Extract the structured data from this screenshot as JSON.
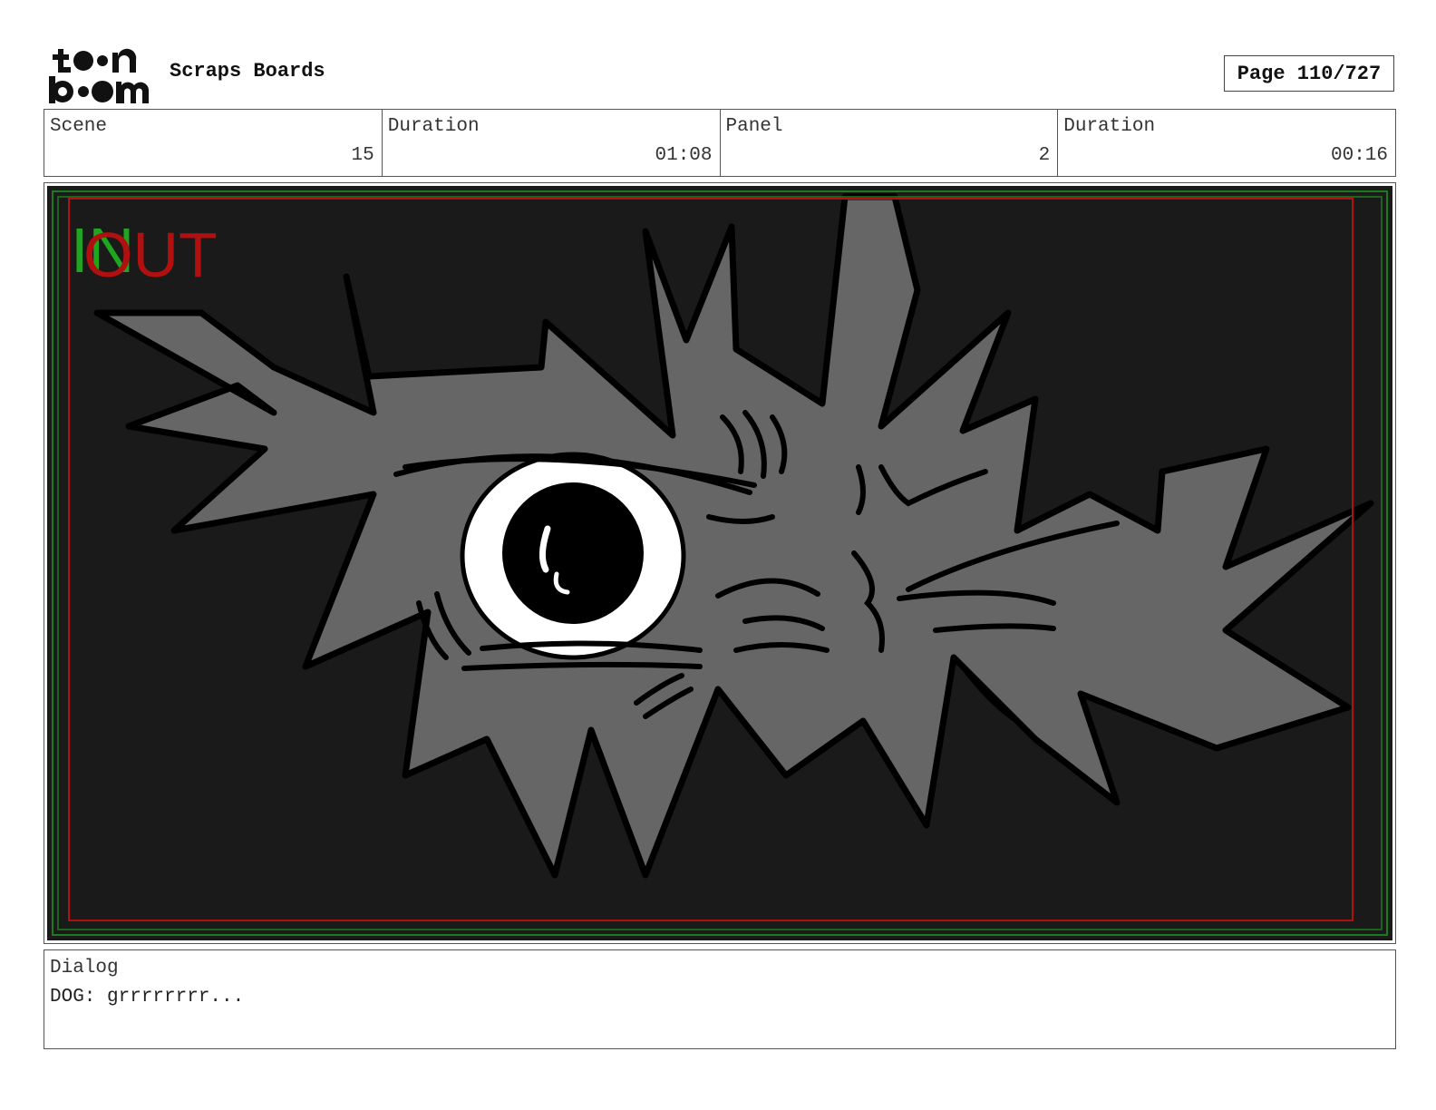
{
  "header": {
    "logo_text": "toon boom",
    "project_title": "Scraps Boards",
    "page_label": "Page 110/727"
  },
  "info": [
    {
      "label": "Scene",
      "value": "15"
    },
    {
      "label": "Duration",
      "value": "01:08"
    },
    {
      "label": "Panel",
      "value": "2"
    },
    {
      "label": "Duration",
      "value": "00:16"
    }
  ],
  "panel": {
    "overlay_in": "IN",
    "overlay_out": "OUT",
    "colors": {
      "background": "#1a1a1a",
      "fur": "#666666",
      "in_marker": "#1fa51f",
      "out_marker": "#b01010",
      "safe_frame_red": "#b01010",
      "safe_frame_green": "#1e7a1e"
    }
  },
  "dialog": {
    "label": "Dialog",
    "text": "DOG: grrrrrrrr..."
  }
}
